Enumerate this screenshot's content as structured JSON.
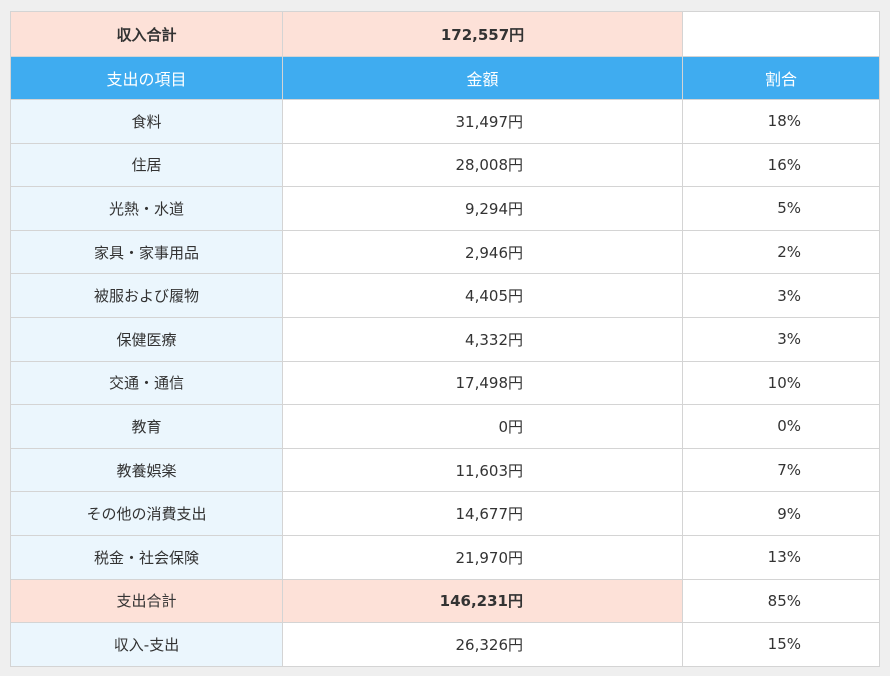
{
  "income": {
    "label": "収入合計",
    "value": "172,557円"
  },
  "header": {
    "item": "支出の項目",
    "amount": "金額",
    "ratio": "割合"
  },
  "rows": [
    {
      "item": "食料",
      "amount": "31,497円",
      "ratio": "18%"
    },
    {
      "item": "住居",
      "amount": "28,008円",
      "ratio": "16%"
    },
    {
      "item": "光熱・水道",
      "amount": "9,294円",
      "ratio": "5%"
    },
    {
      "item": "家具・家事用品",
      "amount": "2,946円",
      "ratio": "2%"
    },
    {
      "item": "被服および履物",
      "amount": "4,405円",
      "ratio": "3%"
    },
    {
      "item": "保健医療",
      "amount": "4,332円",
      "ratio": "3%"
    },
    {
      "item": "交通・通信",
      "amount": "17,498円",
      "ratio": "10%"
    },
    {
      "item": "教育",
      "amount": "0円",
      "ratio": "0%"
    },
    {
      "item": "教養娯楽",
      "amount": "11,603円",
      "ratio": "7%"
    },
    {
      "item": "その他の消費支出",
      "amount": "14,677円",
      "ratio": "9%"
    },
    {
      "item": "税金・社会保険",
      "amount": "21,970円",
      "ratio": "13%"
    }
  ],
  "total": {
    "label": "支出合計",
    "amount": "146,231円",
    "ratio": "85%"
  },
  "balance": {
    "label": "収入-支出",
    "amount": "26,326円",
    "ratio": "15%"
  }
}
